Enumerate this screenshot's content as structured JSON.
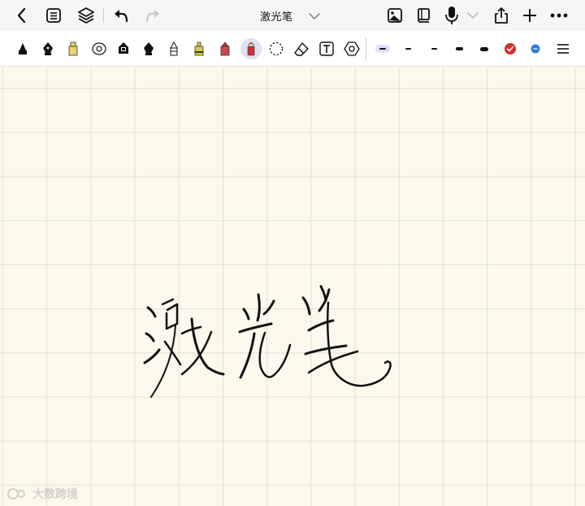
{
  "document": {
    "title": "激光笔"
  },
  "watermark": {
    "text": "大数跨境"
  },
  "toolbar": {
    "tools": [
      "fountain-pen-tool",
      "ink-pen-tool",
      "highlighter-tool",
      "lasso-ring-tool",
      "calligraphy-pen-tool",
      "brush-pen-tool",
      "pencil-tool",
      "yellow-highlighter-tool",
      "red-marker-tool",
      "laser-pointer-tool",
      "lasso-select-tool",
      "eraser-tool",
      "text-tool",
      "shape-tool"
    ],
    "selected_tool": "laser-pointer-tool",
    "stroke_widths": [
      "thinnest",
      "thin",
      "medium",
      "thick",
      "thickest"
    ],
    "selected_width": "thinnest",
    "colors": {
      "primary": "#d32f2f",
      "secondary": "#2f7fe0"
    }
  },
  "colors": {
    "paper": "#fbf8ec",
    "grid": "#e3e0d3",
    "ink": "#111111",
    "accent_selected": "#dfe2f3"
  }
}
